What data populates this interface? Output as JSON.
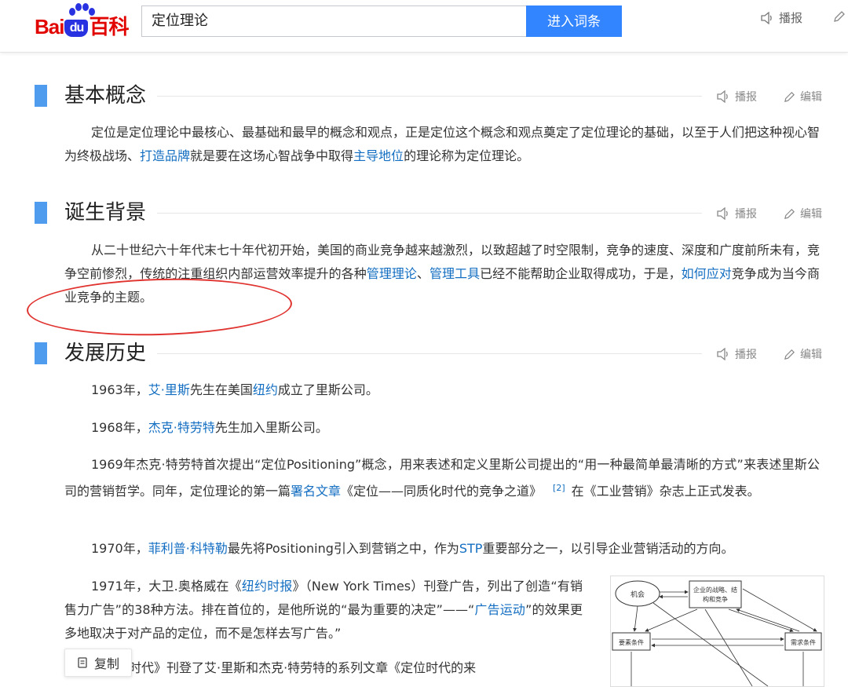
{
  "header": {
    "logo_bai": "Bai",
    "logo_du": "du",
    "logo_baike": "百科",
    "search_value": "定位理论",
    "search_button": "进入词条",
    "tool_play": "播报"
  },
  "sections": [
    {
      "title": "基本概念",
      "tool_play": "播报",
      "tool_edit": "编辑",
      "paragraphs": [
        {
          "t1": "定位是定位理论中最核心、最基础和最早的概念和观点，正是定位这个概念和观点奠定了定位理论的基础，以至于人们把这种视心智为终极战场、",
          "l1": "打造品牌",
          "t2": "就是要在这场心智战争中取得",
          "l2": "主导地位",
          "t3": "的理论称为定位理论。"
        }
      ]
    },
    {
      "title": "诞生背景",
      "tool_play": "播报",
      "tool_edit": "编辑",
      "paragraphs": [
        {
          "t1": "从二十世纪六十年代末七十年代初开始，美国的商业竞争越来越激烈，以致超越了时空限制，竞争的速度、深度和广度前所未有，竞争空前惨烈，传统的注重组织内部运营效率提升的各种",
          "l1": "管理理论",
          "t2": "、",
          "l2": "管理工具",
          "t3": "已经不能帮助企业取得成功，于是，",
          "l3": "如何应对",
          "t4": "竞争成为当今商业竞争的主题。"
        }
      ]
    },
    {
      "title": "发展历史",
      "tool_play": "播报",
      "tool_edit": "编辑",
      "paragraphs": [
        {
          "t1": "1963年，",
          "l1": "艾·里斯",
          "t2": "先生在美国",
          "l2": "纽约",
          "t3": "成立了里斯公司。"
        },
        {
          "t1": "1968年，",
          "l1": "杰克·特劳特",
          "t2": "先生加入里斯公司。"
        },
        {
          "t1": "1969年杰克·特劳特首次提出“定位Positioning”概念，用来表述和定义里斯公司提出的“用一种最简单最清晰的方式”来表述里斯公司的营销哲学。同年，定位理论的第一篇",
          "l1": "署名文章",
          "t2": "《定位——同质化时代的竞争之道》",
          "ref": "[2]",
          "t3": "在《工业营销》杂志上正式发表。"
        },
        {
          "t1": "1970年，",
          "l1": "菲利普·科特勒",
          "t2": "最先将Positioning引入到营销之中，作为",
          "l2": "STP",
          "t3": "重要部分之一，以引导企业营销活动的方向。"
        },
        {
          "t1": "1971年，大卫.奥格威在《",
          "l1": "纽约时报",
          "t2": "》（New York Times）刊登广告，列出了创造“有销售力广告”的38种方法。排在首位的，是他所说的“最为重要的决定”——“",
          "l2": "广告运动",
          "t3": "”的效果更多地取决于对产品的定位，而不是怎样去写广告。”"
        },
        {
          "t1": "《广告时代》刊登了艾·里斯和杰克·特劳特的系列文章《定位时代的来"
        }
      ]
    }
  ],
  "diagram": {
    "node_opportunity": "机会",
    "node_strategy_1": "企业的战略、结",
    "node_strategy_2": "构和竞争",
    "node_factor": "要素条件",
    "node_demand": "需求条件"
  },
  "copy_button": "复制",
  "colors": {
    "link": "#136ec2",
    "accent_bar": "#4f9cee",
    "search_button": "#3385ff",
    "annotation": "#e0332f"
  }
}
